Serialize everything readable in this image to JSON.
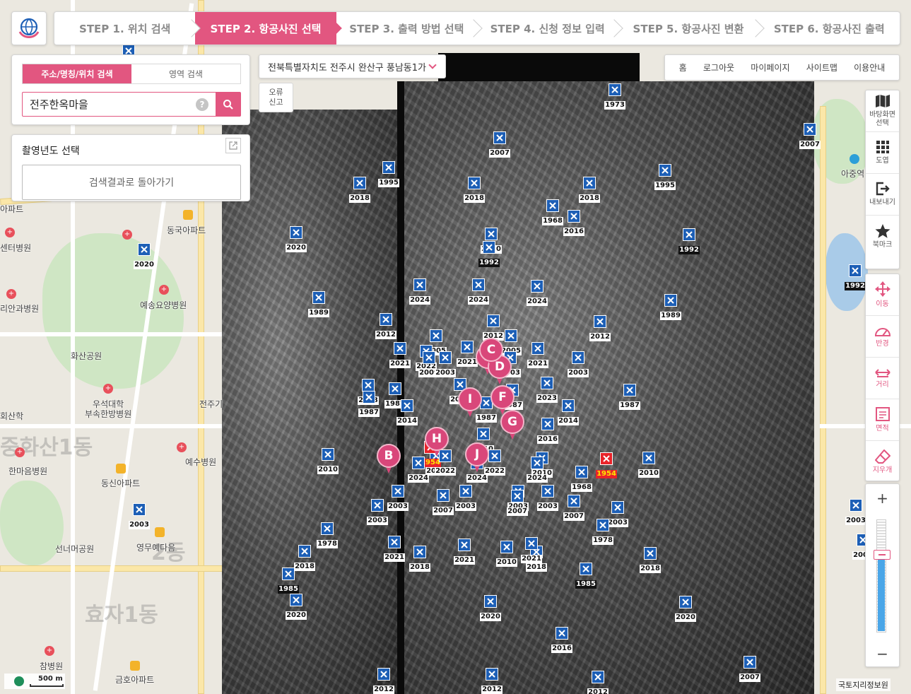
{
  "steps": [
    {
      "label": "STEP 1. 위치 검색",
      "active": false
    },
    {
      "label": "STEP 2. 항공사진 선택",
      "active": true
    },
    {
      "label": "STEP 3. 출력 방법 선택",
      "active": false
    },
    {
      "label": "STEP 4. 신청 정보 입력",
      "active": false
    },
    {
      "label": "STEP 5. 항공사진 변환",
      "active": false
    },
    {
      "label": "STEP 6. 항공사진 출력",
      "active": false
    }
  ],
  "search": {
    "tab_address": "주소/명칭/위치 검색",
    "tab_area": "영역 검색",
    "value": "전주한옥마을",
    "help": "?"
  },
  "year_panel": {
    "title": "촬영년도 선택",
    "back_button": "검색결과로 돌아가기"
  },
  "address_select": "전북특별자치도 전주시 완산구 풍남동1가",
  "report_button": "오류\n신고",
  "topnav": [
    "홈",
    "로그아웃",
    "마이페이지",
    "사이트맵",
    "이용안내"
  ],
  "tools": [
    {
      "label": "바탕화면\n선택",
      "icon": "map-icon"
    },
    {
      "label": "도엽",
      "icon": "grid-icon"
    },
    {
      "label": "내보내기",
      "icon": "export-icon"
    },
    {
      "label": "북마크",
      "icon": "star-icon"
    }
  ],
  "measure_tools": [
    {
      "label": "이동",
      "icon": "move-icon"
    },
    {
      "label": "반경",
      "icon": "radius-icon"
    },
    {
      "label": "거리",
      "icon": "distance-icon"
    },
    {
      "label": "면적",
      "icon": "area-icon"
    },
    {
      "label": "지우개",
      "icon": "eraser-icon"
    }
  ],
  "zoom": {
    "in": "+",
    "out": "−",
    "level_fraction": 0.67
  },
  "map_labels": [
    "동국아파트",
    "예송요양병원",
    "화산공원",
    "우석대학\n부속한방병원",
    "한마음병원",
    "동신아파트",
    "선너머공원",
    "영무예다음",
    "예수병원",
    "참병원",
    "금호아파트",
    "아중역",
    "전주기",
    "리안과병원",
    "회산학",
    "아파트",
    "센터병원",
    "중화산1동",
    "효자1동",
    "2동"
  ],
  "scale_label": "500 m",
  "credit": "국토지리정보원",
  "markers": [
    {
      "year": "1985"
    },
    {
      "year": "1973"
    },
    {
      "year": "2007"
    },
    {
      "year": "2007"
    },
    {
      "year": "1995"
    },
    {
      "year": "2018"
    },
    {
      "year": "2018"
    },
    {
      "year": "2018"
    },
    {
      "year": "1995"
    },
    {
      "year": "1968"
    },
    {
      "year": "2016"
    },
    {
      "year": "2020"
    },
    {
      "year": "2020"
    },
    {
      "year": "1992"
    },
    {
      "year": "2020"
    },
    {
      "year": "1992"
    },
    {
      "year": "1992"
    },
    {
      "year": "2024"
    },
    {
      "year": "2024"
    },
    {
      "year": "2024"
    },
    {
      "year": "1989"
    },
    {
      "year": "1989"
    },
    {
      "year": "2012"
    },
    {
      "year": "2012"
    },
    {
      "year": "2012"
    },
    {
      "year": "2005"
    },
    {
      "year": "2005"
    },
    {
      "year": "2021"
    },
    {
      "year": "2021"
    },
    {
      "year": "2021"
    },
    {
      "year": "2022"
    },
    {
      "year": "2009"
    },
    {
      "year": "2003"
    },
    {
      "year": "2003"
    },
    {
      "year": "2003"
    },
    {
      "year": "2023"
    },
    {
      "year": "2023"
    },
    {
      "year": "2023"
    },
    {
      "year": "1987"
    },
    {
      "year": "1987"
    },
    {
      "year": "1987"
    },
    {
      "year": "1987"
    },
    {
      "year": "1987"
    },
    {
      "year": "2014"
    },
    {
      "year": "2014"
    },
    {
      "year": "2016"
    },
    {
      "year": "2010"
    },
    {
      "year": "2010"
    },
    {
      "year": "2010"
    },
    {
      "year": "2010"
    },
    {
      "year": "2010"
    },
    {
      "year": "1954",
      "red": true
    },
    {
      "year": "1954",
      "red": true
    },
    {
      "year": "2022"
    },
    {
      "year": "2022"
    },
    {
      "year": "2024"
    },
    {
      "year": "2024"
    },
    {
      "year": "2024"
    },
    {
      "year": "1968"
    },
    {
      "year": "2003"
    },
    {
      "year": "2003"
    },
    {
      "year": "2003"
    },
    {
      "year": "2003"
    },
    {
      "year": "2003"
    },
    {
      "year": "2007"
    },
    {
      "year": "2007"
    },
    {
      "year": "2007"
    },
    {
      "year": "2003"
    },
    {
      "year": "2003"
    },
    {
      "year": "1978"
    },
    {
      "year": "1978"
    },
    {
      "year": "2018"
    },
    {
      "year": "2018"
    },
    {
      "year": "2018"
    },
    {
      "year": "2018"
    },
    {
      "year": "2021"
    },
    {
      "year": "2021"
    },
    {
      "year": "2021"
    },
    {
      "year": "2010"
    },
    {
      "year": "1985"
    },
    {
      "year": "1985"
    },
    {
      "year": "2020"
    },
    {
      "year": "2020"
    },
    {
      "year": "2020"
    },
    {
      "year": "2016"
    },
    {
      "year": "2012"
    },
    {
      "year": "2012"
    },
    {
      "year": "2012"
    },
    {
      "year": "2007"
    },
    {
      "year": "2003"
    },
    {
      "year": "2003"
    }
  ],
  "pins": [
    "B",
    "E",
    "D",
    "F",
    "G",
    "H",
    "I",
    "J",
    "C"
  ]
}
